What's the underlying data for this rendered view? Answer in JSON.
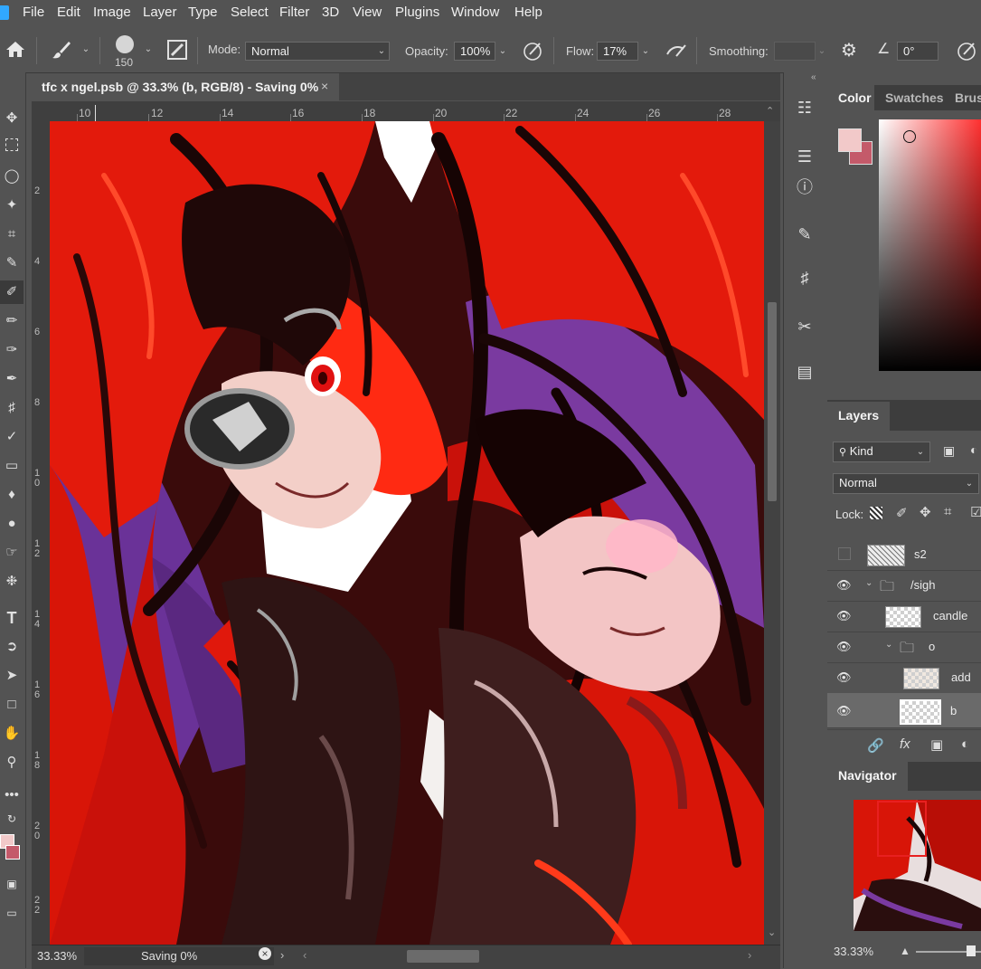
{
  "menu": [
    "File",
    "Edit",
    "Image",
    "Layer",
    "Type",
    "Select",
    "Filter",
    "3D",
    "View",
    "Plugins",
    "Window",
    "Help"
  ],
  "options": {
    "brush_size": "150",
    "mode_label": "Mode:",
    "mode_value": "Normal",
    "opacity_label": "Opacity:",
    "opacity_value": "100%",
    "flow_label": "Flow:",
    "flow_value": "17%",
    "smoothing_label": "Smoothing:",
    "smoothing_value": "",
    "angle_value": "0°"
  },
  "document": {
    "tab_title": "tfc x ngel.psb @ 33.3% (b, RGB/8) - Saving 0%",
    "close_glyph": "×",
    "ruler_h": [
      "10",
      "12",
      "14",
      "16",
      "18",
      "20",
      "22",
      "24",
      "26",
      "28"
    ],
    "ruler_v": [
      "2",
      "4",
      "6",
      "8",
      "1 0",
      "1 2",
      "1 4",
      "1 6",
      "1 8",
      "2 0",
      "2 2"
    ]
  },
  "status": {
    "zoom": "33.33%",
    "saving": "Saving 0%"
  },
  "color_panel": {
    "tabs": [
      "Color",
      "Swatches",
      "Brush"
    ],
    "foreground": "#f2c9c9",
    "background": "#c45a6a"
  },
  "layers_panel": {
    "title": "Layers",
    "filter_label": "Kind",
    "blend_mode": "Normal",
    "lock_label": "Lock:",
    "layers": [
      {
        "name": "s2",
        "visible": false,
        "type": "layer"
      },
      {
        "name": "/sigh",
        "visible": true,
        "type": "group"
      },
      {
        "name": "candle",
        "visible": true,
        "type": "layer"
      },
      {
        "name": "o",
        "visible": true,
        "type": "group"
      },
      {
        "name": "add",
        "visible": true,
        "type": "layer"
      },
      {
        "name": "b",
        "visible": true,
        "type": "layer",
        "selected": true
      }
    ]
  },
  "navigator": {
    "title": "Navigator",
    "zoom": "33.33%"
  },
  "colors": {
    "accent": "#31a8ff",
    "hair_red": "#e31a0c",
    "hair_dark": "#1a0606",
    "purple": "#7a3aa0",
    "skin": "#f3cfc8"
  }
}
